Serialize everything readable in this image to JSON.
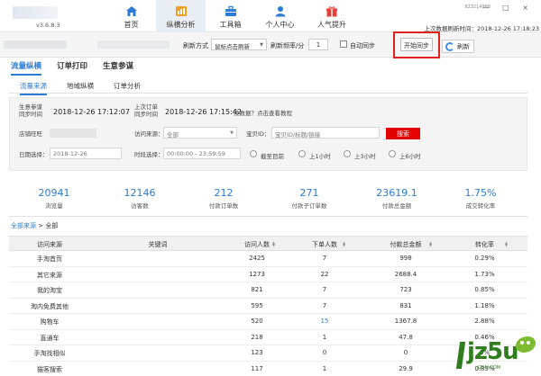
{
  "app": {
    "version": "v3.6.8.3",
    "account_id": "823214988",
    "last_refresh_label": "上次数据刷新时间：2018-12-26 17:18:23",
    "window_controls": "— □ ×"
  },
  "nav": [
    {
      "label": "首页",
      "icon": "home-icon"
    },
    {
      "label": "纵横分析",
      "icon": "bar-chart-icon",
      "active": true
    },
    {
      "label": "工具箱",
      "icon": "toolbox-icon"
    },
    {
      "label": "个人中心",
      "icon": "user-icon"
    },
    {
      "label": "人气提升",
      "icon": "gift-icon"
    }
  ],
  "toolbar": {
    "refresh_mode_label": "刷新方式",
    "refresh_mode_value": "鼠标点击刷新",
    "refresh_rate_label": "刷新频率/分",
    "refresh_rate_value": "1",
    "auto_sync_label": "自动同步",
    "start_sync_label": "开始同步",
    "refresh_label": "刷新"
  },
  "main_tabs": [
    "流量纵横",
    "订单打印",
    "生意参谋"
  ],
  "sub_tabs": [
    "流量来源",
    "地域纵横",
    "订单分析"
  ],
  "filters": {
    "biz_sync_label": "生意参谋\n同步时间",
    "biz_sync_time": "2018-12-26 17:12:07",
    "order_sync_label": "上次订单\n同步时间",
    "order_sync_time": "2018-12-26 17:15:42",
    "no_data_hint": "没数据？点击查看教程",
    "shop_label": "店铺旺旺",
    "source_label": "访问来源：",
    "source_value": "全部",
    "item_id_label": "宝贝ID：",
    "item_id_placeholder": "宝贝ID/标题/链接",
    "search_label": "搜索",
    "date_label": "日期选择：",
    "date_value": "2018-12-26",
    "time_label": "时段选择：",
    "time_value": "00:00:00 - 23:59:59",
    "radios": [
      "截至目前",
      "上1小时",
      "上3小时",
      "上6小时"
    ]
  },
  "stats": [
    {
      "value": "20941",
      "label": "浏览量"
    },
    {
      "value": "12146",
      "label": "访客数"
    },
    {
      "value": "212",
      "label": "付款订单数"
    },
    {
      "value": "271",
      "label": "付款子订单数"
    },
    {
      "value": "23619.1",
      "label": "付款总金额"
    },
    {
      "value": "1.75%",
      "label": "成交转化率"
    }
  ],
  "breadcrumb": {
    "link": "全部来源",
    "current": "> 全部"
  },
  "table": {
    "headers": [
      "访问来源",
      "关键词",
      "访问人数",
      "下单人数",
      "付款总金额",
      "转化率"
    ],
    "rows": [
      [
        "手淘首页",
        "",
        "2425",
        "7",
        "998",
        "0.29%"
      ],
      [
        "其它来源",
        "",
        "1273",
        "22",
        "2688.4",
        "1.73%"
      ],
      [
        "我的淘宝",
        "",
        "821",
        "7",
        "723",
        "0.85%"
      ],
      [
        "淘内免费其他",
        "",
        "595",
        "7",
        "831",
        "1.18%"
      ],
      [
        "购物车",
        "",
        "520",
        "15",
        "1367.8",
        "2.88%"
      ],
      [
        "直通车",
        "",
        "218",
        "1",
        "47.8",
        "0.46%"
      ],
      [
        "手淘找相似",
        "",
        "123",
        "0",
        "0",
        "0%"
      ],
      [
        "猫客搜索",
        "",
        "117",
        "1",
        "29.9",
        "0.85%"
      ]
    ]
  },
  "watermark": {
    "text": "jz5u",
    "sub": "JZ5U.COM"
  },
  "colors": {
    "accent": "#2a7bd6",
    "highlight": "#e0221d",
    "search": "#e40000"
  }
}
